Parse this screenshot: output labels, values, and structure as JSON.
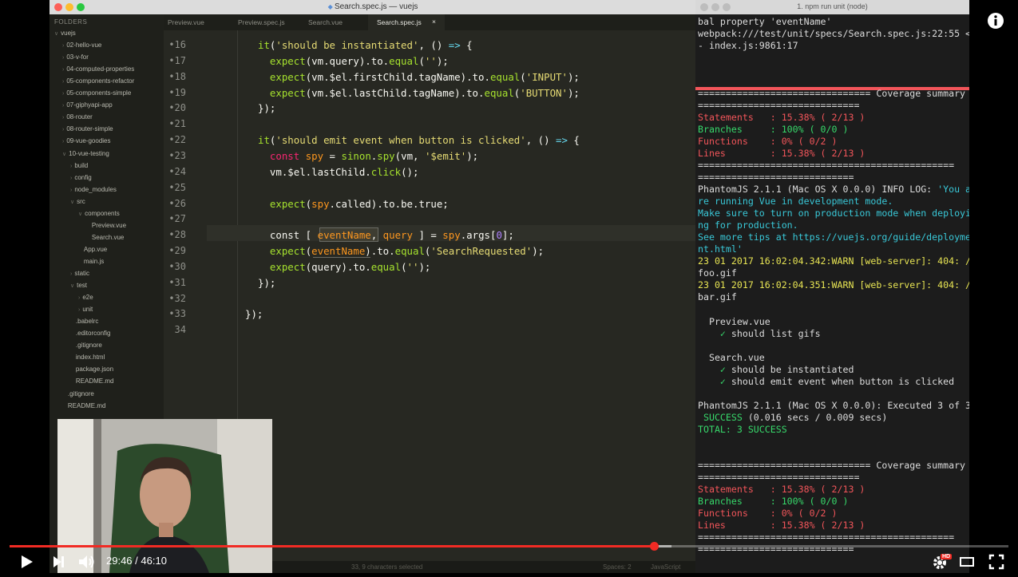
{
  "editor": {
    "window_title": "Search.spec.js — vuejs",
    "sidebar_header": "FOLDERS",
    "tree": [
      {
        "label": "vuejs",
        "depth": 0,
        "open": true
      },
      {
        "label": "02-hello-vue",
        "depth": 1,
        "open": false
      },
      {
        "label": "03-v-for",
        "depth": 1,
        "open": false
      },
      {
        "label": "04-computed-properties",
        "depth": 1,
        "open": false
      },
      {
        "label": "05-components-refactor",
        "depth": 1,
        "open": false
      },
      {
        "label": "05-components-simple",
        "depth": 1,
        "open": false
      },
      {
        "label": "07-giphyapi-app",
        "depth": 1,
        "open": false
      },
      {
        "label": "08-router",
        "depth": 1,
        "open": false
      },
      {
        "label": "08-router-simple",
        "depth": 1,
        "open": false
      },
      {
        "label": "09-vue-goodies",
        "depth": 1,
        "open": false
      },
      {
        "label": "10-vue-testing",
        "depth": 1,
        "open": true
      },
      {
        "label": "build",
        "depth": 2,
        "open": false
      },
      {
        "label": "config",
        "depth": 2,
        "open": false
      },
      {
        "label": "node_modules",
        "depth": 2,
        "open": false
      },
      {
        "label": "src",
        "depth": 2,
        "open": true
      },
      {
        "label": "components",
        "depth": 3,
        "open": true
      },
      {
        "label": "Preview.vue",
        "depth": 4,
        "file": true
      },
      {
        "label": "Search.vue",
        "depth": 4,
        "file": true
      },
      {
        "label": "App.vue",
        "depth": 3,
        "file": true
      },
      {
        "label": "main.js",
        "depth": 3,
        "file": true
      },
      {
        "label": "static",
        "depth": 2,
        "open": false
      },
      {
        "label": "test",
        "depth": 2,
        "open": true
      },
      {
        "label": "e2e",
        "depth": 3,
        "open": false
      },
      {
        "label": "unit",
        "depth": 3,
        "open": false
      },
      {
        "label": ".babelrc",
        "depth": 2,
        "file": true
      },
      {
        "label": ".editorconfig",
        "depth": 2,
        "file": true
      },
      {
        "label": ".gitignore",
        "depth": 2,
        "file": true
      },
      {
        "label": "index.html",
        "depth": 2,
        "file": true
      },
      {
        "label": "package.json",
        "depth": 2,
        "file": true
      },
      {
        "label": "README.md",
        "depth": 2,
        "file": true
      },
      {
        "label": ".gitignore",
        "depth": 1,
        "file": true
      },
      {
        "label": "README.md",
        "depth": 1,
        "file": true
      }
    ],
    "tabs": [
      "Preview.vue",
      "Preview.spec.js",
      "Search.vue",
      "Search.spec.js"
    ],
    "active_tab": 3,
    "tab_close": "×",
    "line_numbers": [
      "•16",
      "•17",
      "•18",
      "•19",
      "•20",
      "•21",
      "•22",
      "•23",
      "•24",
      "•25",
      "•26",
      "•27",
      "•28",
      "•29",
      "•30",
      "•31",
      "•32",
      "•33",
      "34"
    ],
    "code_lines": [
      [
        [
          "f",
          "it"
        ],
        [
          "",
          "("
        ],
        [
          "s",
          "'should be instantiated'"
        ],
        [
          "",
          ", () "
        ],
        [
          "p",
          "=>"
        ],
        [
          "",
          " {"
        ]
      ],
      [
        [
          "",
          "  "
        ],
        [
          "f",
          "expect"
        ],
        [
          "",
          "(vm.query).to."
        ],
        [
          "f",
          "equal"
        ],
        [
          "",
          "("
        ],
        [
          "s",
          "''"
        ],
        [
          "",
          ");"
        ]
      ],
      [
        [
          "",
          "  "
        ],
        [
          "f",
          "expect"
        ],
        [
          "",
          "(vm.$el.firstChild.tagName).to."
        ],
        [
          "f",
          "equal"
        ],
        [
          "",
          "("
        ],
        [
          "s",
          "'INPUT'"
        ],
        [
          "",
          ");"
        ]
      ],
      [
        [
          "",
          "  "
        ],
        [
          "f",
          "expect"
        ],
        [
          "",
          "(vm.$el.lastChild.tagName).to."
        ],
        [
          "f",
          "equal"
        ],
        [
          "",
          "("
        ],
        [
          "s",
          "'BUTTON'"
        ],
        [
          "",
          ");"
        ]
      ],
      [
        [
          "",
          "});"
        ]
      ],
      [],
      [
        [
          "f",
          "it"
        ],
        [
          "",
          "("
        ],
        [
          "s",
          "'should emit event when button is clicked'"
        ],
        [
          "",
          ", () "
        ],
        [
          "p",
          "=>"
        ],
        [
          "",
          " {"
        ]
      ],
      [
        [
          "",
          "  "
        ],
        [
          "k",
          "const"
        ],
        [
          "",
          " "
        ],
        [
          "v",
          "spy"
        ],
        [
          "",
          " = "
        ],
        [
          "f",
          "sinon"
        ],
        [
          "",
          "."
        ],
        [
          "f",
          "spy"
        ],
        [
          "",
          "(vm, "
        ],
        [
          "s",
          "'$emit'"
        ],
        [
          "",
          ");"
        ]
      ],
      [
        [
          "",
          "  vm.$el.lastChild."
        ],
        [
          "f",
          "click"
        ],
        [
          "",
          "();"
        ]
      ],
      [],
      [
        [
          "",
          "  "
        ],
        [
          "f",
          "expect"
        ],
        [
          "",
          "("
        ],
        [
          "v",
          "spy"
        ],
        [
          "",
          ".called).to.be.true;"
        ]
      ],
      [],
      [
        [
          "",
          "  const [ "
        ],
        [
          "v",
          "eventName"
        ],
        [
          "",
          ", "
        ],
        [
          "v",
          "query"
        ],
        [
          "",
          " ] = "
        ],
        [
          "v",
          "spy"
        ],
        [
          "",
          ".args["
        ],
        [
          "n",
          "0"
        ],
        [
          "",
          "];"
        ]
      ],
      [
        [
          "",
          "  "
        ],
        [
          "f",
          "expect"
        ],
        [
          "",
          "("
        ],
        [
          "v",
          "eventName"
        ],
        [
          "",
          ").to."
        ],
        [
          "f",
          "equal"
        ],
        [
          "",
          "("
        ],
        [
          "s",
          "'SearchRequested'"
        ],
        [
          "",
          ");"
        ]
      ],
      [
        [
          "",
          "  "
        ],
        [
          "f",
          "expect"
        ],
        [
          "",
          "(query).to."
        ],
        [
          "f",
          "equal"
        ],
        [
          "",
          "("
        ],
        [
          "s",
          "''"
        ],
        [
          "",
          ");"
        ]
      ],
      [
        [
          "",
          "});"
        ]
      ],
      [],
      [
        [
          "",
          "});"
        ]
      ],
      []
    ],
    "status_text": "33, 9 characters selected",
    "status_right": [
      "Spaces: 2",
      "JavaScript"
    ]
  },
  "terminal": {
    "window_title": "1. npm run unit (node)",
    "lines": [
      [
        [
          "",
          "bal property 'eventName'"
        ]
      ],
      [
        [
          "",
          "webpack:///test/unit/specs/Search.spec.js:22:55 <"
        ]
      ],
      [
        [
          "",
          "- index.js:9861:17"
        ]
      ],
      [],
      [],
      [],
      [
        [
          "",
          "=============================== Coverage summary"
        ]
      ],
      [
        [
          "",
          "============================="
        ]
      ],
      [
        [
          "r",
          "Statements   : 15.38% ( 2/13 )"
        ]
      ],
      [
        [
          "g",
          "Branches     : 100% ( 0/0 )"
        ]
      ],
      [
        [
          "r",
          "Functions    : 0% ( 0/2 )"
        ]
      ],
      [
        [
          "r",
          "Lines        : 15.38% ( 2/13 )"
        ]
      ],
      [
        [
          "",
          "=============================================="
        ]
      ],
      [
        [
          "",
          "============================"
        ]
      ],
      [
        [
          "",
          "PhantomJS 2.1.1 (Mac OS X 0.0.0) INFO LOG: "
        ],
        [
          "c",
          "'You a"
        ]
      ],
      [
        [
          "c",
          "re running Vue in development mode."
        ]
      ],
      [
        [
          "c",
          "Make sure to turn on production mode when deployi"
        ]
      ],
      [
        [
          "c",
          "ng for production."
        ]
      ],
      [
        [
          "c",
          "See more tips at https://vuejs.org/guide/deployme"
        ]
      ],
      [
        [
          "c",
          "nt.html'"
        ]
      ],
      [
        [
          "y",
          "23 01 2017 16:02:04.342:WARN [web-server]: 404: /"
        ]
      ],
      [
        [
          "",
          "foo.gif"
        ]
      ],
      [
        [
          "y",
          "23 01 2017 16:02:04.351:WARN [web-server]: 404: /"
        ]
      ],
      [
        [
          "",
          "bar.gif"
        ]
      ],
      [],
      [
        [
          "",
          "  Preview.vue"
        ]
      ],
      [
        [
          "g",
          "    ✓ "
        ],
        [
          "",
          "should list gifs"
        ]
      ],
      [],
      [
        [
          "",
          "  Search.vue"
        ]
      ],
      [
        [
          "g",
          "    ✓ "
        ],
        [
          "",
          "should be instantiated"
        ]
      ],
      [
        [
          "g",
          "    ✓ "
        ],
        [
          "",
          "should emit event when button is clicked"
        ]
      ],
      [],
      [
        [
          "",
          "PhantomJS 2.1.1 (Mac OS X 0.0.0): Executed 3 of 3"
        ]
      ],
      [
        [
          "g",
          " SUCCESS"
        ],
        [
          "",
          " (0.016 secs / 0.009 secs)"
        ]
      ],
      [
        [
          "g",
          "TOTAL: 3 SUCCESS"
        ]
      ],
      [],
      [],
      [
        [
          "",
          "=============================== Coverage summary"
        ]
      ],
      [
        [
          "",
          "============================="
        ]
      ],
      [
        [
          "r",
          "Statements   : 15.38% ( 2/13 )"
        ]
      ],
      [
        [
          "g",
          "Branches     : 100% ( 0/0 )"
        ]
      ],
      [
        [
          "r",
          "Functions    : 0% ( 0/2 )"
        ]
      ],
      [
        [
          "r",
          "Lines        : 15.38% ( 2/13 )"
        ]
      ],
      [
        [
          "",
          "=============================================="
        ]
      ],
      [
        [
          "",
          "============================"
        ]
      ]
    ]
  },
  "player": {
    "current_time": "29:46",
    "duration": "46:10",
    "separator": " / ",
    "progress_fraction": 0.6447,
    "buffer_fraction": 0.663,
    "hd_badge": "HD",
    "accent": "#f12b24"
  },
  "icons": {
    "play": "play-icon",
    "next": "next-icon",
    "volume": "volume-icon",
    "settings": "gear-icon",
    "theater": "theater-mode-icon",
    "fullscreen": "fullscreen-icon",
    "info": "info-icon"
  }
}
